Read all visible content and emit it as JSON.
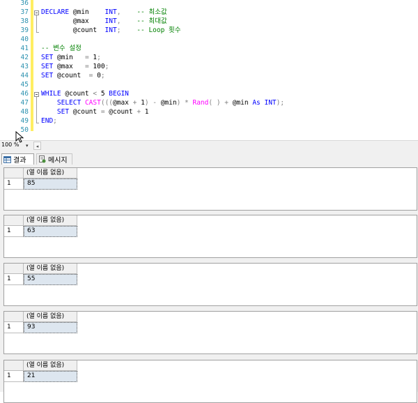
{
  "editor": {
    "lines": [
      {
        "num": "36",
        "tokens": []
      },
      {
        "num": "37",
        "tokens": [
          {
            "t": "DECLARE",
            "c": "kw"
          },
          {
            "t": " @min    ",
            "c": "pl"
          },
          {
            "t": "INT",
            "c": "kw"
          },
          {
            "t": ",",
            "c": "op"
          },
          {
            "t": "    -- 최소값",
            "c": "cm"
          }
        ]
      },
      {
        "num": "38",
        "tokens": [
          {
            "t": "        @max    ",
            "c": "pl"
          },
          {
            "t": "INT",
            "c": "kw"
          },
          {
            "t": ",",
            "c": "op"
          },
          {
            "t": "    -- 최대값",
            "c": "cm"
          }
        ]
      },
      {
        "num": "39",
        "tokens": [
          {
            "t": "        @count  ",
            "c": "pl"
          },
          {
            "t": "INT",
            "c": "kw"
          },
          {
            "t": ";",
            "c": "op"
          },
          {
            "t": "    -- Loop 횟수",
            "c": "cm"
          }
        ]
      },
      {
        "num": "40",
        "tokens": []
      },
      {
        "num": "41",
        "tokens": [
          {
            "t": "-- 변수 설정",
            "c": "cm"
          }
        ]
      },
      {
        "num": "42",
        "tokens": [
          {
            "t": "SET",
            "c": "kw"
          },
          {
            "t": " @min   ",
            "c": "pl"
          },
          {
            "t": "= ",
            "c": "op"
          },
          {
            "t": "1",
            "c": "pl"
          },
          {
            "t": ";",
            "c": "op"
          }
        ]
      },
      {
        "num": "43",
        "tokens": [
          {
            "t": "SET",
            "c": "kw"
          },
          {
            "t": " @max   ",
            "c": "pl"
          },
          {
            "t": "= ",
            "c": "op"
          },
          {
            "t": "100",
            "c": "pl"
          },
          {
            "t": ";",
            "c": "op"
          }
        ]
      },
      {
        "num": "44",
        "tokens": [
          {
            "t": "SET",
            "c": "kw"
          },
          {
            "t": " @count  ",
            "c": "pl"
          },
          {
            "t": "= ",
            "c": "op"
          },
          {
            "t": "0",
            "c": "pl"
          },
          {
            "t": ";",
            "c": "op"
          }
        ]
      },
      {
        "num": "45",
        "tokens": []
      },
      {
        "num": "46",
        "tokens": [
          {
            "t": "WHILE",
            "c": "kw"
          },
          {
            "t": " @count ",
            "c": "pl"
          },
          {
            "t": "< ",
            "c": "op"
          },
          {
            "t": "5 ",
            "c": "pl"
          },
          {
            "t": "BEGIN",
            "c": "kw"
          }
        ]
      },
      {
        "num": "47",
        "tokens": [
          {
            "t": "    ",
            "c": "pl"
          },
          {
            "t": "SELECT",
            "c": "kw"
          },
          {
            "t": " ",
            "c": "pl"
          },
          {
            "t": "CAST",
            "c": "fn"
          },
          {
            "t": "(((",
            "c": "op"
          },
          {
            "t": "@max ",
            "c": "pl"
          },
          {
            "t": "+ ",
            "c": "op"
          },
          {
            "t": "1",
            "c": "pl"
          },
          {
            "t": ") - ",
            "c": "op"
          },
          {
            "t": "@min",
            "c": "pl"
          },
          {
            "t": ") * ",
            "c": "op"
          },
          {
            "t": "Rand",
            "c": "fn"
          },
          {
            "t": "( ) + ",
            "c": "op"
          },
          {
            "t": "@min ",
            "c": "pl"
          },
          {
            "t": "As ",
            "c": "kw"
          },
          {
            "t": "INT",
            "c": "kw"
          },
          {
            "t": ");",
            "c": "op"
          }
        ]
      },
      {
        "num": "48",
        "tokens": [
          {
            "t": "    ",
            "c": "pl"
          },
          {
            "t": "SET",
            "c": "kw"
          },
          {
            "t": " @count ",
            "c": "pl"
          },
          {
            "t": "= ",
            "c": "op"
          },
          {
            "t": "@count ",
            "c": "pl"
          },
          {
            "t": "+ ",
            "c": "op"
          },
          {
            "t": "1",
            "c": "pl"
          }
        ]
      },
      {
        "num": "49",
        "tokens": [
          {
            "t": "END",
            "c": "kw"
          },
          {
            "t": ";",
            "c": "op"
          }
        ]
      },
      {
        "num": "50",
        "tokens": []
      }
    ]
  },
  "zoom": {
    "level": "100 %"
  },
  "tabs": {
    "results": "결과",
    "messages": "메시지"
  },
  "results": [
    {
      "column": "(열 이름 없음)",
      "row": "1",
      "value": "85"
    },
    {
      "column": "(열 이름 없음)",
      "row": "1",
      "value": "63"
    },
    {
      "column": "(열 이름 없음)",
      "row": "1",
      "value": "55"
    },
    {
      "column": "(열 이름 없음)",
      "row": "1",
      "value": "93"
    },
    {
      "column": "(열 이름 없음)",
      "row": "1",
      "value": "21"
    }
  ],
  "icons": {
    "results_tab": "grid-icon",
    "messages_tab": "message-icon",
    "zoom_drop": "chevron-down-icon",
    "scroll_left": "arrow-left-icon"
  }
}
